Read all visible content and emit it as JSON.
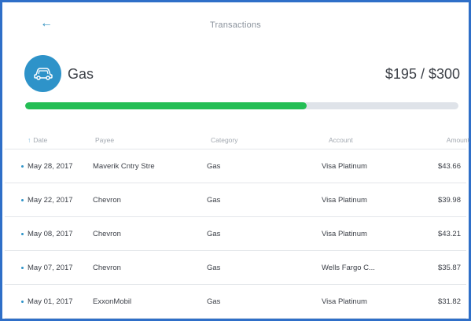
{
  "nav": {
    "title": "Transactions",
    "back_icon": "arrow-left-icon"
  },
  "budget": {
    "category_name": "Gas",
    "category_icon": "car-icon",
    "amount_text": "$195 / $300",
    "spent": 195,
    "limit": 300,
    "progress_fraction": 0.65,
    "colors": {
      "icon_bg": "#2e93c9",
      "progress_fill": "#24be55",
      "progress_track": "#dfe3e9"
    }
  },
  "table": {
    "columns": {
      "date": "Date",
      "payee": "Payee",
      "category": "Category",
      "account": "Account",
      "amount": "Amount"
    },
    "rows": [
      {
        "date": "May 28, 2017",
        "payee": "Maverik Cntry Stre",
        "category": "Gas",
        "account": "Visa Platinum",
        "amount": "$43.66"
      },
      {
        "date": "May 22, 2017",
        "payee": "Chevron",
        "category": "Gas",
        "account": "Visa Platinum",
        "amount": "$39.98"
      },
      {
        "date": "May 08, 2017",
        "payee": "Chevron",
        "category": "Gas",
        "account": "Visa Platinum",
        "amount": "$43.21"
      },
      {
        "date": "May 07, 2017",
        "payee": "Chevron",
        "category": "Gas",
        "account": "Wells Fargo C...",
        "amount": "$35.87"
      },
      {
        "date": "May 01, 2017",
        "payee": "ExxonMobil",
        "category": "Gas",
        "account": "Visa Platinum",
        "amount": "$31.82"
      }
    ]
  }
}
